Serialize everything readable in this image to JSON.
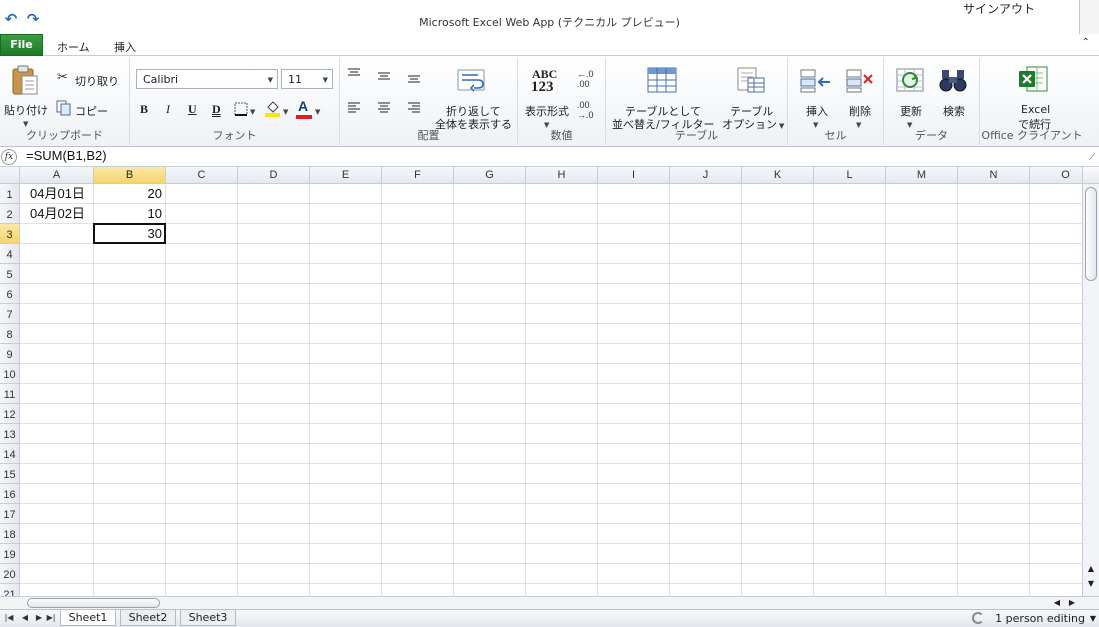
{
  "titlebar": {
    "title": "Microsoft Excel Web App (テクニカル プレビュー)",
    "sign_out": "サインアウト",
    "undo_icon": "undo-icon",
    "redo_icon": "redo-icon"
  },
  "tabs": {
    "file": "File",
    "home": "ホーム",
    "insert": "挿入"
  },
  "ribbon": {
    "clipboard": {
      "label": "クリップボード",
      "paste": "貼り付け",
      "cut": "切り取り",
      "copy": "コピー"
    },
    "font": {
      "label": "フォント",
      "font_name": "Calibri",
      "font_size": "11",
      "bold": "B",
      "italic": "I",
      "underline": "U",
      "double_underline": "D",
      "font_color_glyph": "A",
      "fill_color": "#ffe600",
      "font_color": "#e02020"
    },
    "alignment": {
      "label": "配置",
      "wrap_text_line1": "折り返して",
      "wrap_text_line2": "全体を表示する"
    },
    "number": {
      "label": "数値",
      "format_glyph_top": "ABC",
      "format_glyph_bottom": "123",
      "number_format": "表示形式"
    },
    "table": {
      "label": "テーブル",
      "format_as_table_line1": "テーブルとして",
      "format_as_table_line2": "並べ替え/フィルター",
      "table_options_line1": "テーブル",
      "table_options_line2": "オプション"
    },
    "cells": {
      "label": "セル",
      "insert": "挿入",
      "delete": "削除"
    },
    "data": {
      "label": "データ",
      "refresh": "更新",
      "find": "検索"
    },
    "office_client": {
      "label": "Office クライアント",
      "open_line1": "Excel",
      "open_line2": "で続行"
    }
  },
  "formula_bar": {
    "fx": "fx",
    "formula": "=SUM(B1,B2)"
  },
  "grid": {
    "columns": [
      "A",
      "B",
      "C",
      "D",
      "E",
      "F",
      "G",
      "H",
      "I",
      "J",
      "K",
      "L",
      "M",
      "N",
      "O"
    ],
    "rows": [
      "1",
      "2",
      "3",
      "4",
      "5",
      "6",
      "7",
      "8",
      "9",
      "10",
      "11",
      "12",
      "13",
      "14",
      "15",
      "16",
      "17",
      "18",
      "19",
      "20",
      "21"
    ],
    "selected_column": "B",
    "selected_row": "3",
    "cells": {
      "A1": "04月01日",
      "B1": "20",
      "A2": "04月02日",
      "B2": "10",
      "B3": "30"
    }
  },
  "sheets": [
    "Sheet1",
    "Sheet2",
    "Sheet3"
  ],
  "active_sheet": "Sheet1",
  "status": {
    "editing": "1 person editing"
  },
  "colors": {
    "file_tab": "#2a8a36",
    "selection_header": "#f6d46e"
  }
}
